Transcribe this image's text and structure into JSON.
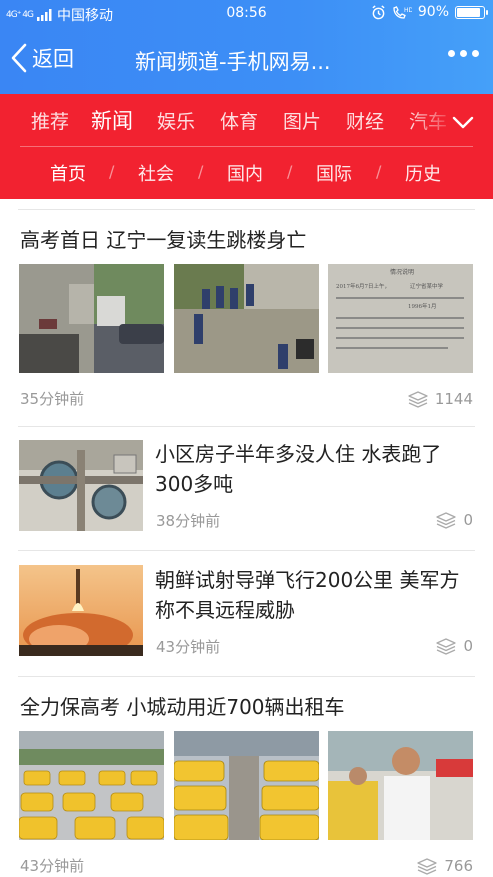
{
  "status_bar": {
    "network": "4G⁺ 4G",
    "carrier": "中国移动",
    "time": "08:56",
    "hd": "HD",
    "battery_text": "90%",
    "battery_level": 0.9
  },
  "header": {
    "back_label": "返回",
    "title": "新闻频道-手机网易..."
  },
  "channel_tabs": [
    {
      "label": "推荐",
      "active": false
    },
    {
      "label": "新闻",
      "active": true
    },
    {
      "label": "娱乐",
      "active": false
    },
    {
      "label": "体育",
      "active": false
    },
    {
      "label": "图片",
      "active": false
    },
    {
      "label": "财经",
      "active": false
    },
    {
      "label": "汽车",
      "active": false
    }
  ],
  "sub_tabs": [
    {
      "label": "首页",
      "active": true
    },
    {
      "label": "社会",
      "active": false
    },
    {
      "label": "国内",
      "active": false
    },
    {
      "label": "国际",
      "active": false
    },
    {
      "label": "历史",
      "active": false
    }
  ],
  "sub_tab_separator": "/",
  "articles": [
    {
      "title": "高考首日 辽宁一复读生跳楼身亡",
      "time": "35分钟前",
      "comments": "1144",
      "layout": "three-images"
    },
    {
      "title": "小区房子半年多没人住 水表跑了300多吨",
      "time": "38分钟前",
      "comments": "0",
      "layout": "single-image"
    },
    {
      "title": "朝鲜试射导弹飞行200公里 美军方称不具远程威胁",
      "time": "43分钟前",
      "comments": "0",
      "layout": "single-image"
    },
    {
      "title": "全力保高考 小城动用近700辆出租车",
      "time": "43分钟前",
      "comments": "766",
      "layout": "three-images"
    }
  ],
  "document_image_text": {
    "lines": [
      "情况说明",
      "2017年6月7日上午，",
      "辽宁省某中学",
      "1996年1月"
    ]
  },
  "colors": {
    "header_blue": "#3d8ff6",
    "channel_red": "#f22230",
    "meta_gray": "#999999"
  }
}
